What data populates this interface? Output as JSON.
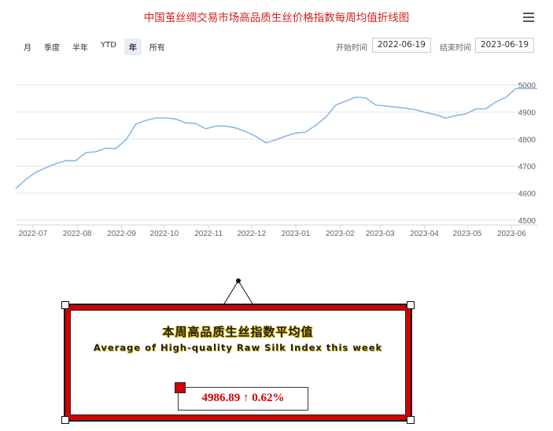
{
  "title": "中国茧丝绸交易市场高品质生丝价格指数每周均值折线图",
  "range_buttons": [
    "月",
    "季度",
    "半年",
    "YTD",
    "年",
    "所有"
  ],
  "active_range": "年",
  "start_label": "开始时间",
  "start_date": "2022-06-19",
  "end_label": "结束时间",
  "end_date": "2023-06-19",
  "panel": {
    "title_cn": "本周高品质生丝指数平均值",
    "title_en": "Average of High-quality Raw Silk Index this week",
    "value": "4986.89 ↑ 0.62%"
  },
  "colors": {
    "line": "#8ab9e6",
    "title": "#d42020",
    "panel_border": "#d10000",
    "accent_text": "#d10000"
  },
  "chart_data": {
    "type": "line",
    "title": "中国茧丝绸交易市场高品质生丝价格指数每周均值折线图",
    "x_tick_labels": [
      "2022-07",
      "2022-08",
      "2022-09",
      "2022-10",
      "2022-11",
      "2022-12",
      "2023-01",
      "2023-02",
      "2023-03",
      "2023-04",
      "2023-05",
      "2023-06"
    ],
    "y_ticks": [
      4500,
      4600,
      4700,
      4800,
      4900,
      5000
    ],
    "ylim": [
      4500,
      5000
    ],
    "xlim": [
      "2022-06-19",
      "2023-06-19"
    ],
    "grid": true,
    "series": [
      {
        "x": [
          "2022-06-19",
          "2022-06-26",
          "2022-07-03",
          "2022-07-10",
          "2022-07-17",
          "2022-07-24",
          "2022-07-31",
          "2022-08-07",
          "2022-08-14",
          "2022-08-21",
          "2022-08-28",
          "2022-09-04",
          "2022-09-11",
          "2022-09-18",
          "2022-09-25",
          "2022-10-02",
          "2022-10-09",
          "2022-10-16",
          "2022-10-23",
          "2022-10-30",
          "2022-11-06",
          "2022-11-13",
          "2022-11-20",
          "2022-11-27",
          "2022-12-04",
          "2022-12-11",
          "2022-12-18",
          "2022-12-25",
          "2023-01-01",
          "2023-01-08",
          "2023-01-15",
          "2023-01-22",
          "2023-01-29",
          "2023-02-05",
          "2023-02-12",
          "2023-02-19",
          "2023-02-26",
          "2023-03-05",
          "2023-03-12",
          "2023-03-19",
          "2023-03-26",
          "2023-04-02",
          "2023-04-09",
          "2023-04-16",
          "2023-04-23",
          "2023-04-30",
          "2023-05-07",
          "2023-05-14",
          "2023-05-21",
          "2023-05-28",
          "2023-06-04",
          "2023-06-11",
          "2023-06-19"
        ],
        "values": [
          4617,
          4651,
          4677,
          4694,
          4709,
          4720,
          4720,
          4750,
          4753,
          4766,
          4765,
          4796,
          4855,
          4869,
          4878,
          4878,
          4874,
          4860,
          4857,
          4838,
          4848,
          4848,
          4841,
          4828,
          4810,
          4786,
          4797,
          4811,
          4822,
          4826,
          4851,
          4881,
          4926,
          4940,
          4955,
          4952,
          4926,
          4922,
          4918,
          4914,
          4908,
          4898,
          4890,
          4877,
          4887,
          4893,
          4911,
          4912,
          4937,
          4954,
          4987,
          4987,
          4987
        ]
      }
    ]
  }
}
